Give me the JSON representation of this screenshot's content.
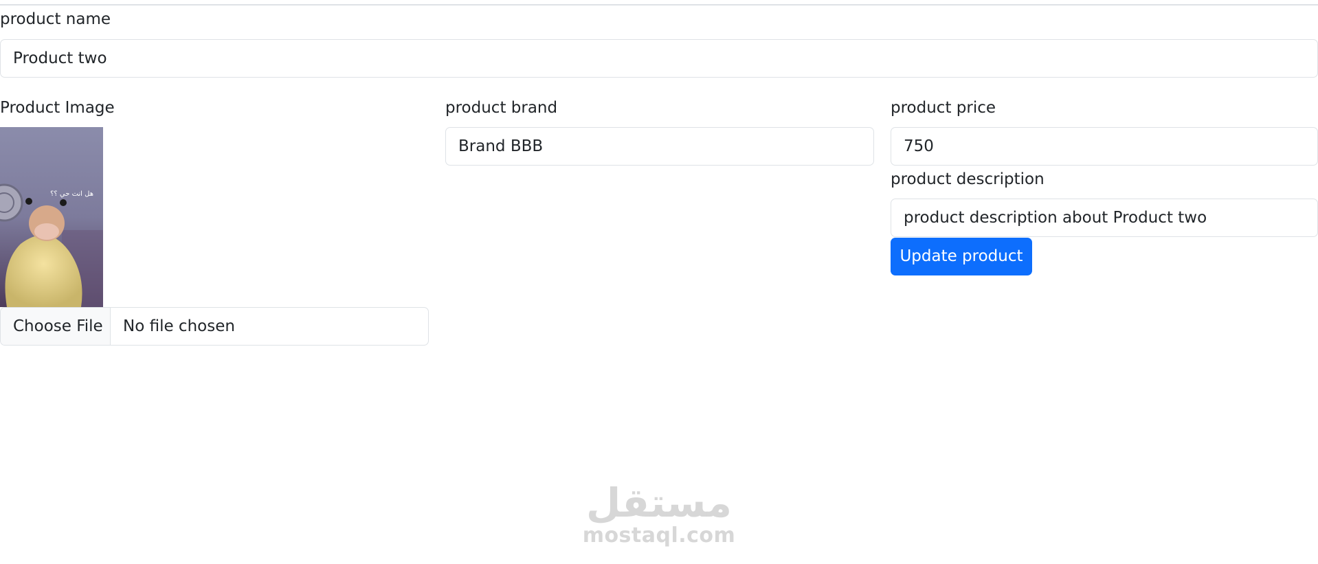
{
  "form": {
    "name": {
      "label": "product name",
      "value": "Product two"
    },
    "image": {
      "label": "Product Image",
      "image_caption": "هل انت حي ؟؟",
      "file_button": "Choose File",
      "file_status": "No file chosen"
    },
    "brand": {
      "label": "product brand",
      "value": "Brand BBB"
    },
    "price": {
      "label": "product price",
      "value": "750"
    },
    "description": {
      "label": "product description",
      "value": "product description about Product two"
    },
    "submit_label": "Update product"
  },
  "watermark": {
    "arabic": "مستقل",
    "latin": "mostaql.com"
  },
  "colors": {
    "primary": "#0d6efd",
    "border": "#dee2e6",
    "text": "#212529",
    "watermark": "#d7d7d7"
  }
}
